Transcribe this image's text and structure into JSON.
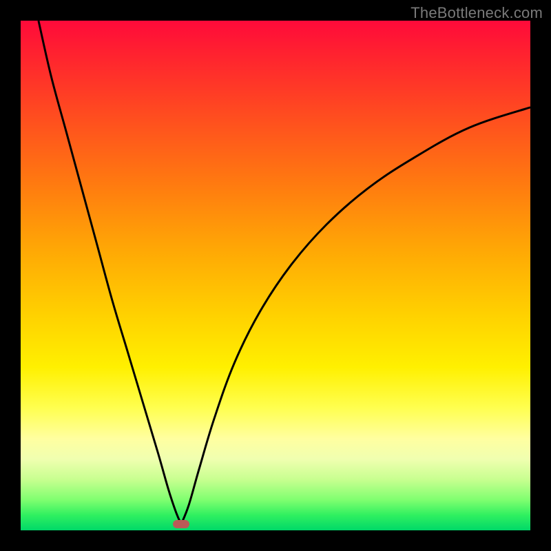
{
  "watermark": "TheBottleneck.com",
  "colors": {
    "frame": "#000000",
    "curve_stroke": "#000000",
    "marker_fill": "#bb5a57",
    "gradient_top": "#ff0a3a",
    "gradient_bottom": "#00d868"
  },
  "chart_data": {
    "type": "line",
    "title": "",
    "xlabel": "",
    "ylabel": "",
    "xlim": [
      0,
      100
    ],
    "ylim": [
      0,
      100
    ],
    "grid": false,
    "legend": false,
    "description": "V-shaped bottleneck curve over red-to-green vertical gradient; minimum near x≈31.5. Left branch steeper than right branch. Black frame border. Small rounded marker at the curve minimum near the bottom.",
    "marker": {
      "x": 31.5,
      "y": 1.2
    },
    "series": [
      {
        "name": "left-branch",
        "x": [
          3.5,
          6,
          9,
          12,
          15,
          18,
          21,
          24,
          27,
          29,
          30.5,
          31.5
        ],
        "y": [
          100,
          89,
          78,
          67,
          56,
          45,
          35,
          25,
          15,
          8,
          3.5,
          1.2
        ]
      },
      {
        "name": "right-branch",
        "x": [
          31.5,
          33,
          35,
          38,
          42,
          47,
          53,
          60,
          68,
          77,
          88,
          100
        ],
        "y": [
          1.2,
          5,
          12,
          22,
          33,
          43,
          52,
          60,
          67,
          73,
          79,
          83
        ]
      }
    ]
  }
}
